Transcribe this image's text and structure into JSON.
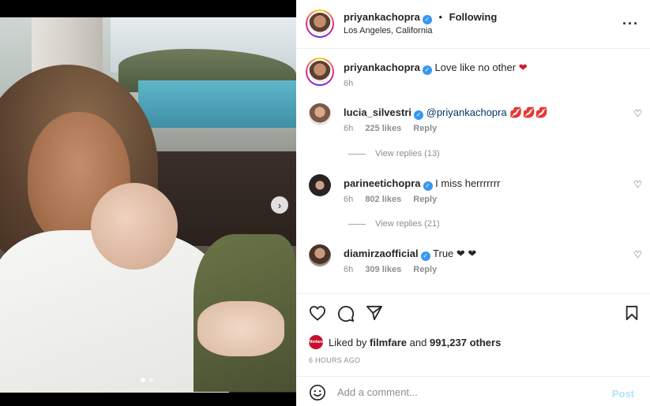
{
  "post": {
    "author": "priyankachopra",
    "follow_sep": "•",
    "follow_status": "Following",
    "location": "Los Angeles, California",
    "more_icon": "more-horizontal-icon",
    "caption": {
      "username": "priyankachopra",
      "text": "Love like no other",
      "emoji": "❤",
      "time": "6h"
    }
  },
  "comments": [
    {
      "username": "lucia_silvestri",
      "mention": "@priyankachopra",
      "text": "💋💋💋",
      "time": "6h",
      "likes": "225 likes",
      "reply": "Reply",
      "replies_label": "View replies (13)"
    },
    {
      "username": "parineetichopra",
      "text": "I miss herrrrrrr",
      "time": "6h",
      "likes": "802 likes",
      "reply": "Reply",
      "replies_label": "View replies (21)"
    },
    {
      "username": "diamirzaofficial",
      "text": "True ❤ ❤",
      "time": "6h",
      "likes": "309 likes",
      "reply": "Reply"
    }
  ],
  "engagement": {
    "liked_prefix": "Liked by",
    "liked_user": "filmfare",
    "and_label": "and",
    "liked_count": "991,237 others",
    "liked_avatar_label": "filmfare",
    "posted_ago": "6 HOURS AGO"
  },
  "composer": {
    "placeholder": "Add a comment...",
    "post_label": "Post"
  },
  "carousel": {
    "slide_count": 2,
    "active_index": 0
  },
  "colors": {
    "verified": "#3897f0",
    "heart": "#e0112b",
    "post_disabled": "#b2dffc",
    "mention": "#00376b"
  }
}
